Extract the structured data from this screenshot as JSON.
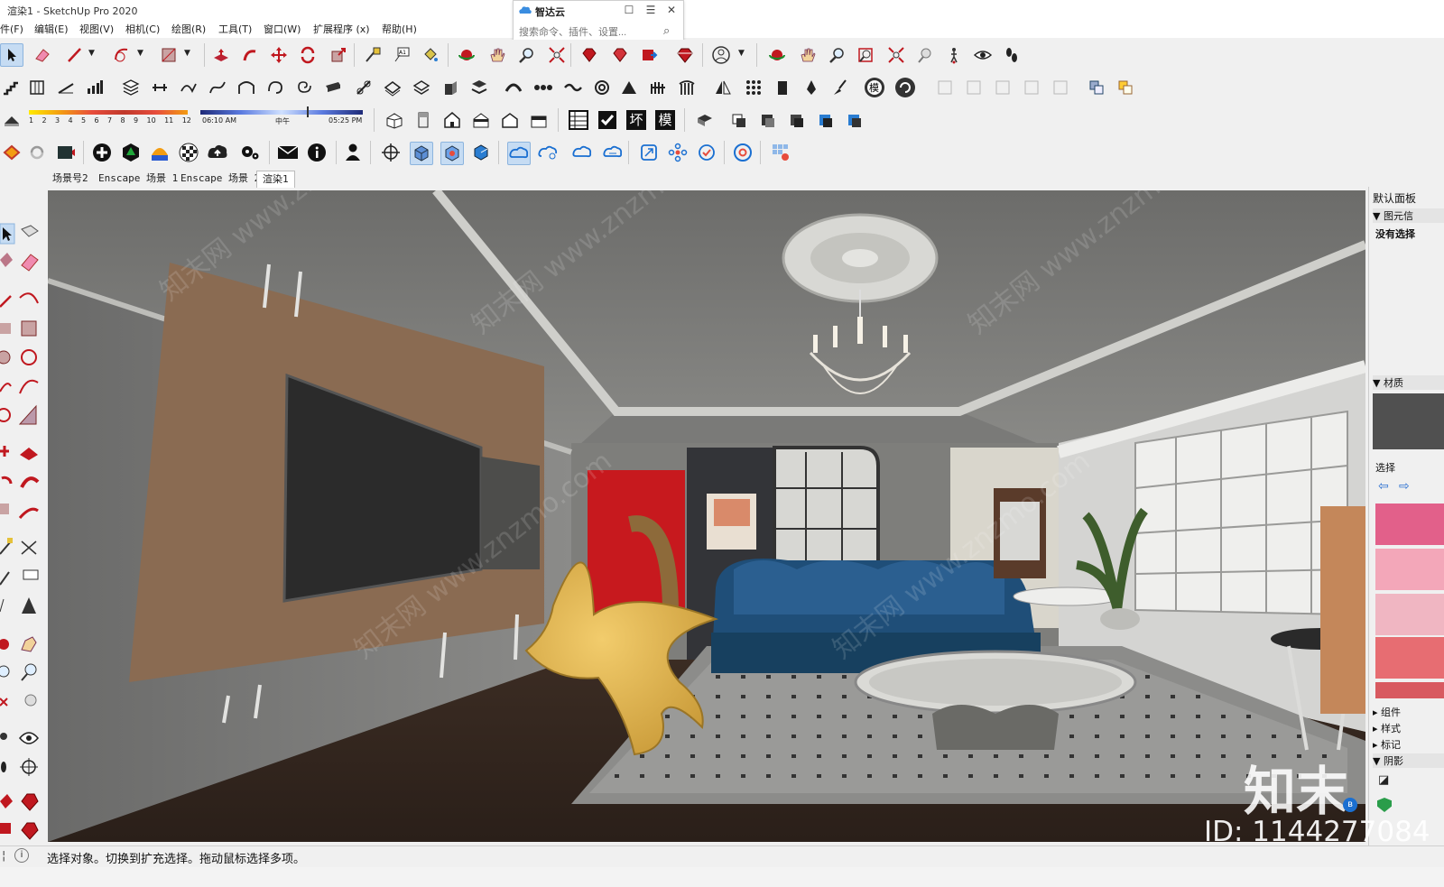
{
  "window": {
    "title": "渲染1 - SketchUp Pro 2020"
  },
  "zhidayun": {
    "title": "智达云",
    "search_placeholder": "搜索命令、插件、设置...",
    "btn_restore": "☐",
    "btn_menu": "☰",
    "btn_close": "✕"
  },
  "menu": [
    "件(F)",
    "编辑(E)",
    "视图(V)",
    "相机(C)",
    "绘图(R)",
    "工具(T)",
    "窗口(W)",
    "扩展程序 (x)",
    "帮助(H)"
  ],
  "shadow_toolbar": {
    "months": [
      "1",
      "2",
      "3",
      "4",
      "5",
      "6",
      "7",
      "8",
      "9",
      "10",
      "11",
      "12"
    ],
    "time_start": "06:10 AM",
    "time_mid": "中午",
    "time_end": "05:25 PM"
  },
  "icon_letters": {
    "wall": "坏",
    "model": "模",
    "model_circle": "模"
  },
  "scenes": {
    "tabs": [
      "场景号2",
      "Enscape 场景 1",
      "Enscape 场景 2",
      "渲染1"
    ],
    "active_index": 3
  },
  "right_panel": {
    "title": "默认面板",
    "entity_info": "▼ 图元信",
    "no_selection": "没有选择",
    "materials": "▼ 材质",
    "select_tab": "选择",
    "components": "▸ 组件",
    "styles": "▸ 样式",
    "tags": "▸ 标记",
    "shadows": "▼ 阴影"
  },
  "status": {
    "text": "选择对象。切换到扩充选择。拖动鼠标选择多项。"
  },
  "watermarks": {
    "brand": "知末",
    "id": "ID: 1144277084",
    "repeat": "知末网 www.znzmo.com"
  },
  "colors": {
    "accent_red": "#d7262e",
    "selection_blue": "#c6dcf3",
    "swatch_pink1": "#e2608a",
    "swatch_pink2": "#f3a7b9",
    "swatch_coral": "#e76d72",
    "material_preview": "#505050"
  }
}
